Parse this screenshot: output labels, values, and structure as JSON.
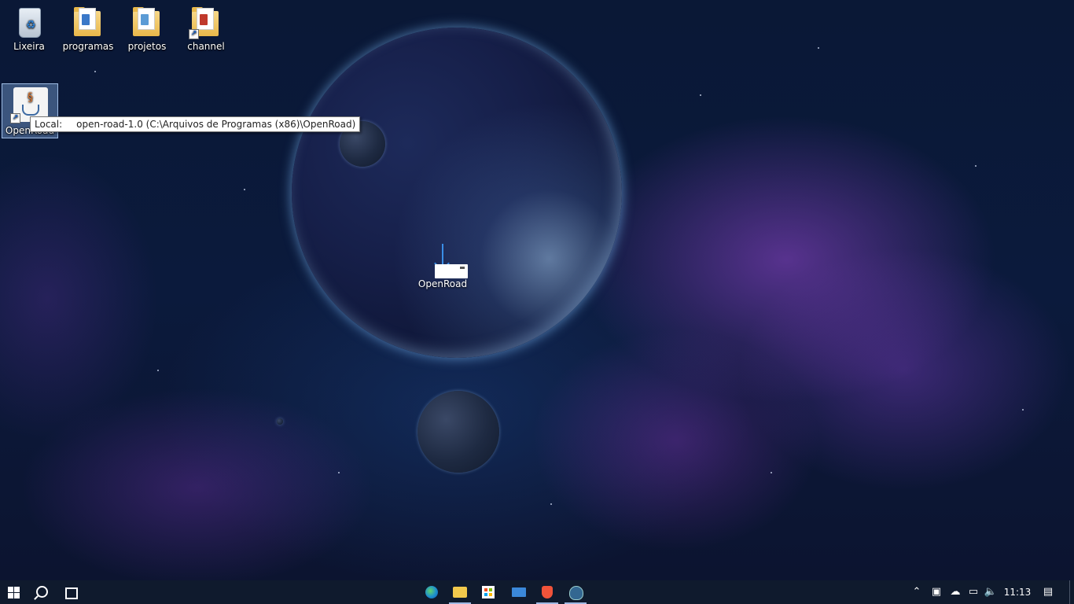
{
  "desktop": {
    "icons": [
      {
        "label": "Lixeira"
      },
      {
        "label": "programas"
      },
      {
        "label": "projetos"
      },
      {
        "label": "channel"
      },
      {
        "label": "OpenRoad"
      }
    ],
    "tooltip": {
      "key": "Local:",
      "value": "open-road-1.0 (C:\\Arquivos de Programas (x86)\\OpenRoad)"
    },
    "drag_ghost": {
      "label": "OpenRoad"
    }
  },
  "taskbar": {
    "clock": "11:13",
    "pinned_apps": [
      "edge-icon",
      "file-explorer-icon",
      "microsoft-store-icon",
      "mail-icon",
      "brave-icon",
      "pgadmin-icon"
    ],
    "active_accent": "#9fb8e3"
  },
  "colors": {
    "taskbar_bg": "#0f1a2d",
    "selection_bg": "rgba(120,160,210,0.45)"
  }
}
